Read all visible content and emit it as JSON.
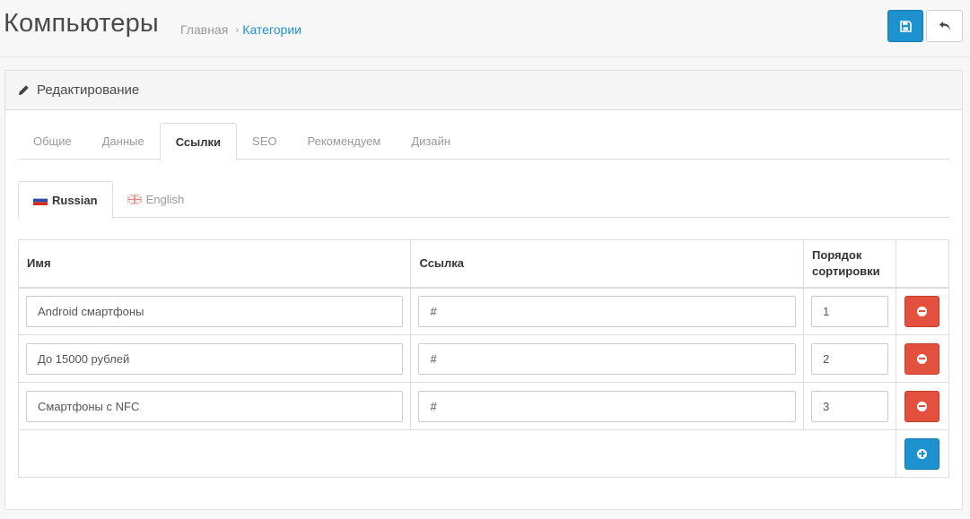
{
  "header": {
    "title": "Компьютеры",
    "breadcrumb": {
      "home": "Главная",
      "separator": "›",
      "current": "Категории"
    },
    "save_icon": "save-icon",
    "back_icon": "reply-icon"
  },
  "panel": {
    "title": "Редактирование",
    "icon": "pencil-icon"
  },
  "tabs": [
    {
      "label": "Общие",
      "active": false
    },
    {
      "label": "Данные",
      "active": false
    },
    {
      "label": "Ссылки",
      "active": true
    },
    {
      "label": "SEO",
      "active": false
    },
    {
      "label": "Рекомендуем",
      "active": false
    },
    {
      "label": "Дизайн",
      "active": false
    }
  ],
  "languages": [
    {
      "label": "Russian",
      "flag": "ru-flag-icon",
      "active": true
    },
    {
      "label": "English",
      "flag": "gb-flag-icon",
      "active": false
    }
  ],
  "table": {
    "columns": [
      "Имя",
      "Ссылка",
      "Порядок сортировки",
      ""
    ],
    "rows": [
      {
        "name": "Android смартфоны",
        "link": "#",
        "sort": "1"
      },
      {
        "name": "До 15000 рублей",
        "link": "#",
        "sort": "2"
      },
      {
        "name": "Смартфоны с NFC",
        "link": "#",
        "sort": "3"
      }
    ]
  },
  "colors": {
    "primary": "#1e91cf",
    "danger": "#e3503e",
    "link": "#1e91cf"
  }
}
